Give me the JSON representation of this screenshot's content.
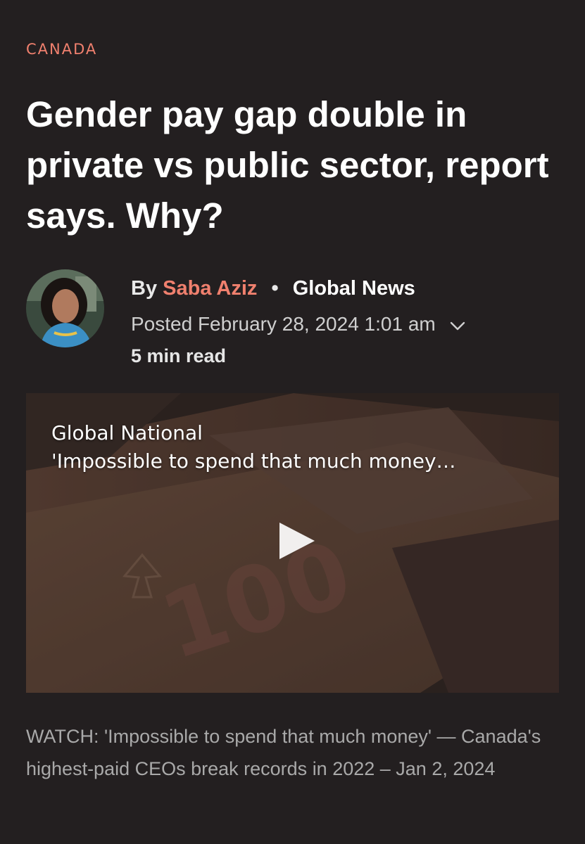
{
  "article": {
    "category": "CANADA",
    "headline": "Gender pay gap double in private vs public sector, report says. Why?",
    "byline": {
      "by": "By",
      "author": "Saba Aziz",
      "separator": "•",
      "outlet": "Global News"
    },
    "posted": "Posted February 28, 2024 1:01 am",
    "read_time": "5 min read"
  },
  "video": {
    "program": "Global National",
    "title": "'Impossible to spend that much money…",
    "banknote_text": "100"
  },
  "caption": "WATCH: 'Impossible to spend that much money' — Canada's highest-paid CEOs break records in 2022 – Jan 2, 2024",
  "colors": {
    "background": "#231f20",
    "accent": "#f0806e",
    "caption": "#a9a9a9"
  },
  "icons": {
    "chevron": "chevron-down-icon",
    "play": "play-icon",
    "avatar": "author-avatar"
  }
}
